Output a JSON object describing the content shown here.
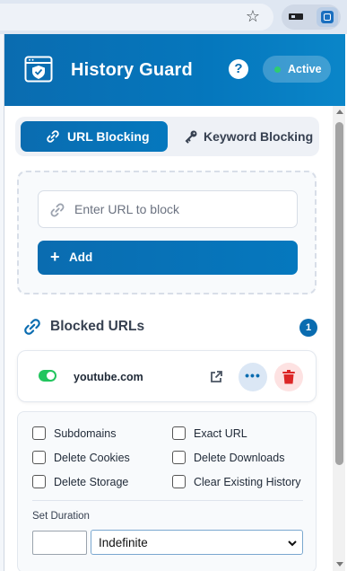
{
  "app": {
    "title": "History Guard",
    "help_label": "?",
    "status_label": "Active"
  },
  "tabs": [
    {
      "label": "URL Blocking",
      "icon": "link-icon",
      "active": true
    },
    {
      "label": "Keyword Blocking",
      "icon": "key-icon",
      "active": false
    }
  ],
  "add_form": {
    "placeholder": "Enter URL to block",
    "add_label": "Add"
  },
  "blocked_section": {
    "title": "Blocked URLs",
    "count": "1"
  },
  "blocked_urls": [
    {
      "url": "youtube.com",
      "enabled": true
    }
  ],
  "options": {
    "subdomains": "Subdomains",
    "exact_url": "Exact URL",
    "delete_cookies": "Delete Cookies",
    "delete_downloads": "Delete Downloads",
    "delete_storage": "Delete Storage",
    "clear_history": "Clear Existing History",
    "duration_label": "Set Duration",
    "duration_value": "Indefinite"
  },
  "colors": {
    "brand": "#0a6cb0",
    "active_dot": "#2ecc71",
    "toggle_on": "#22c55e",
    "delete": "#dc2626"
  }
}
